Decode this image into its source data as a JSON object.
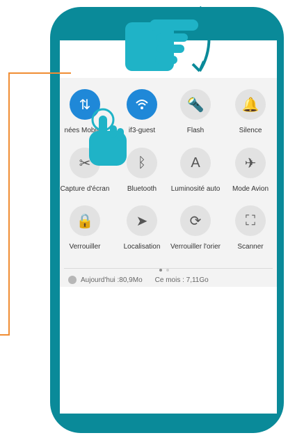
{
  "quick_settings": {
    "tiles": [
      {
        "label": "nées Mobiles",
        "icon": "mobile-data-icon",
        "active": true
      },
      {
        "label": "if3-guest",
        "icon": "wifi-icon",
        "active": true
      },
      {
        "label": "Flash",
        "icon": "flashlight-icon",
        "active": false
      },
      {
        "label": "Silence",
        "icon": "bell-icon",
        "active": false
      },
      {
        "label": "Capture d'écran",
        "icon": "screenshot-icon",
        "active": false
      },
      {
        "label": "Bluetooth",
        "icon": "bluetooth-icon",
        "active": false
      },
      {
        "label": "Luminosité auto",
        "icon": "auto-brightness-icon",
        "active": false
      },
      {
        "label": "Mode Avion",
        "icon": "airplane-icon",
        "active": false
      },
      {
        "label": "Verrouiller",
        "icon": "lock-icon",
        "active": false
      },
      {
        "label": "Localisation",
        "icon": "location-icon",
        "active": false
      },
      {
        "label": "Verrouiller l'orier",
        "icon": "rotation-lock-icon",
        "active": false
      },
      {
        "label": "Scanner",
        "icon": "scanner-icon",
        "active": false
      }
    ],
    "usage_today": "Aujourd'hui :80,9Mo",
    "usage_month": "Ce mois : 7,11Go"
  },
  "colors": {
    "phone": "#0a8a99",
    "active_tile": "#1f88d8",
    "callout_line": "#f08d33"
  }
}
